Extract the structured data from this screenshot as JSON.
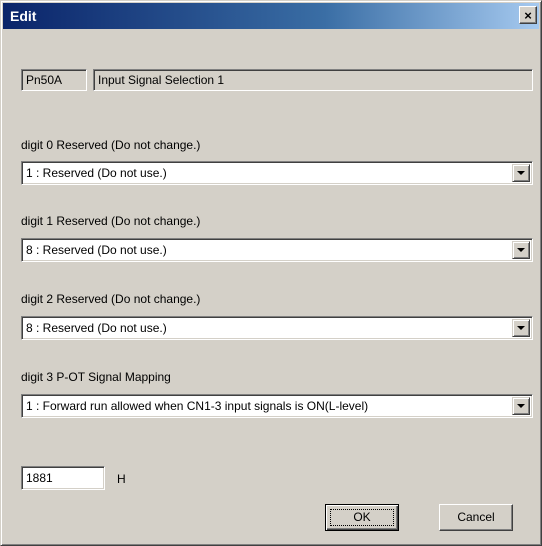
{
  "window": {
    "title": "Edit",
    "close_glyph": "×"
  },
  "parameter": {
    "number": "Pn50A",
    "name": "Input Signal Selection 1"
  },
  "digits": [
    {
      "label": "digit 0  Reserved (Do not change.)",
      "selected": "1 : Reserved (Do not use.)"
    },
    {
      "label": "digit 1  Reserved (Do not change.)",
      "selected": "8 : Reserved (Do not use.)"
    },
    {
      "label": "digit 2  Reserved (Do not change.)",
      "selected": "8 : Reserved (Do not use.)"
    },
    {
      "label": "digit 3  P-OT Signal Mapping",
      "selected": "1 : Forward run allowed when CN1-3 input signals is ON(L-level)"
    }
  ],
  "value": {
    "text": "1881",
    "unit": "H"
  },
  "buttons": {
    "ok": "OK",
    "cancel": "Cancel"
  },
  "colors": {
    "face": "#d4d0c8",
    "title_start": "#0a246a",
    "title_end": "#a6caf0"
  },
  "icons": {
    "close": "close-icon",
    "dropdown": "chevron-down-icon"
  }
}
